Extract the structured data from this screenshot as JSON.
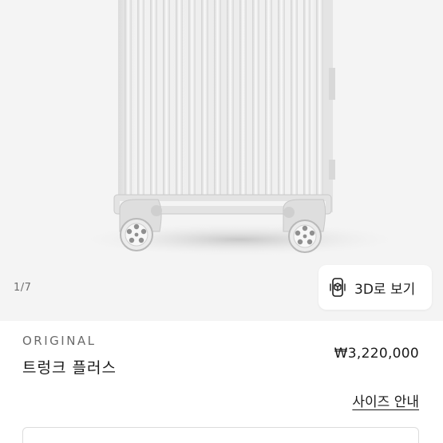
{
  "gallery": {
    "counter": "1/7",
    "view3d_label": "3D로 보기"
  },
  "product": {
    "collection": "ORIGINAL",
    "name": "트렁크 플러스",
    "price": "₩3,220,000",
    "size_guide_label": "사이즈 안내"
  }
}
